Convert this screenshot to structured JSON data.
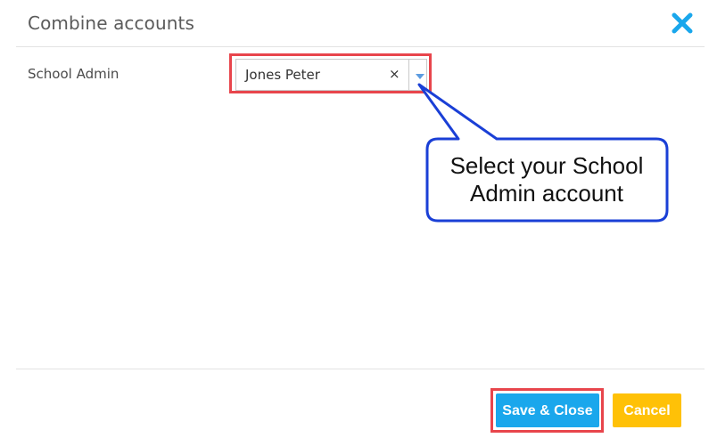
{
  "dialog": {
    "title": "Combine accounts",
    "close_icon": "close-x-icon"
  },
  "form": {
    "school_admin_label": "School Admin",
    "school_admin_value": "Jones Peter",
    "clear_symbol": "×",
    "arrow_icon": "chevron-down-icon"
  },
  "callout": {
    "text_line1": "Select your School",
    "text_line2": "Admin account",
    "border_color": "#1a3fd6"
  },
  "footer": {
    "save_label": "Save & Close",
    "cancel_label": "Cancel"
  },
  "colors": {
    "primary": "#1aa7ec",
    "warning": "#ffc107",
    "highlight": "#e8454c"
  }
}
